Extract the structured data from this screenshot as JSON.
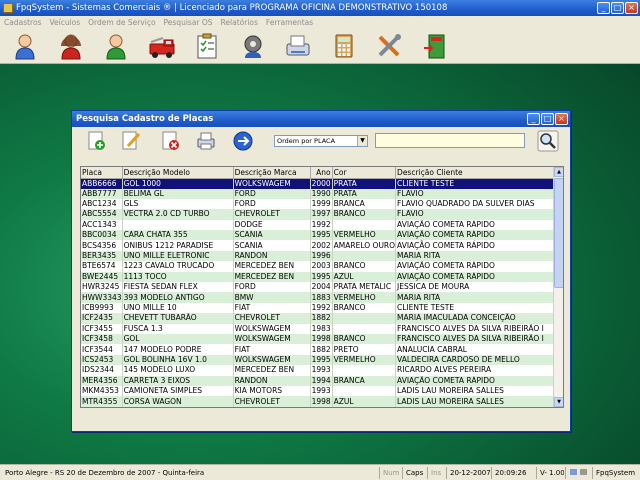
{
  "app": {
    "title": "FpqSystem - Sistemas Comerciais ® | Licenciado para  PROGRAMA OFICINA DEMONSTRATIVO 150108"
  },
  "menu": [
    "Cadastros",
    "Veículos",
    "Ordem de Serviço",
    "Pesquisar OS",
    "Relatórios",
    "Ferramentas"
  ],
  "toolbar_icons": [
    "client-person-icon",
    "user-red-icon",
    "user-green-icon",
    "fire-truck-icon",
    "clipboard-checklist-icon",
    "mechanic-icon",
    "fax-printer-icon",
    "calculator-icon",
    "tools-icon",
    "exit-door-icon"
  ],
  "dialog": {
    "title": "Pesquisa Cadastro de Placas",
    "order_value": "Ordem por PLACA",
    "search_value": "",
    "columns": [
      "Placa",
      "Descrição Modelo",
      "Descrição Marca",
      "Ano",
      "Cor",
      "Descrição Cliente"
    ],
    "rows": [
      [
        "ABB6666",
        "GOL 1000",
        "WOLKSWAGEM",
        "2000",
        "PRATA",
        "CLIENTE TESTE"
      ],
      [
        "ABB7777",
        "BELIMA GL",
        "FORD",
        "1990",
        "PRATA",
        "FLAVIO"
      ],
      [
        "ABC1234",
        "GLS",
        "FORD",
        "1999",
        "BRANCA",
        "FLAVIO QUADRADO DA SULVER DIAS"
      ],
      [
        "ABC5554",
        "VECTRA 2.0 CD TURBO",
        "CHEVROLET",
        "1997",
        "BRANCO",
        "FLAVIO"
      ],
      [
        "ACC1343",
        "",
        "DODGE",
        "1992",
        "",
        "AVIAÇÃO COMETA RÁPIDO"
      ],
      [
        "BBC0034",
        "CARA CHATA 355",
        "SCANIA",
        "1995",
        "VERMELHO",
        "AVIAÇÃO COMETA RÁPIDO"
      ],
      [
        "BCS4356",
        "ONIBUS 1212 PARADISE",
        "SCANIA",
        "2002",
        "AMARELO OURO",
        "AVIAÇÃO COMETA RÁPIDO"
      ],
      [
        "BER3435",
        "UNO MILLE ELETRONIC",
        "RANDON",
        "1996",
        "",
        "MARIA RITA"
      ],
      [
        "BTE6574",
        "1223 CAVALO TRUCADO",
        "MERCEDEZ BEN",
        "2003",
        "BRANCO",
        "AVIAÇÃO COMETA RÁPIDO"
      ],
      [
        "BWE2445",
        "1113 TOCO",
        "MERCEDEZ BEN",
        "1995",
        "AZUL",
        "AVIAÇÃO COMETA RÁPIDO"
      ],
      [
        "HWR3245",
        "FIESTA SEDAN FLEX",
        "FORD",
        "2004",
        "PRATA METALIC",
        "JESSICA DE MOURA"
      ],
      [
        "HWW3343",
        "393 MODELO ANTIGO",
        "BMW",
        "1883",
        "VERMELHO",
        "MARIA RITA"
      ],
      [
        "ICB9993",
        "UNO MILLE 10",
        "FIAT",
        "1992",
        "BRANCO",
        "CLIENTE TESTE"
      ],
      [
        "ICF2435",
        "CHEVETT TUBARÃO",
        "CHEVROLET",
        "1882",
        "",
        "MARIA IMACULADA CONCEIÇÃO"
      ],
      [
        "ICF3455",
        "FUSCA 1.3",
        "WOLKSWAGEM",
        "1983",
        "",
        "FRANCISCO ALVES DA SILVA RIBEIRÃO I"
      ],
      [
        "ICF3458",
        "GOL",
        "WOLKSWAGEM",
        "1998",
        "BRANCO",
        "FRANCISCO ALVES DA SILVA RIBEIRÃO I"
      ],
      [
        "ICF3544",
        "147 MODELO PODRE",
        "FIAT",
        "1882",
        "PRETO",
        "ANALUCIA CABRAL"
      ],
      [
        "ICS2453",
        "GOL BOLINHA 16V 1.0",
        "WOLKSWAGEM",
        "1995",
        "VERMELHO",
        "VALDECIRA CARDOSO DE MELLO"
      ],
      [
        "IDS2344",
        "145 MODELO LUXO",
        "MERCEDEZ BEN",
        "1993",
        "",
        "RICARDO ALVES PEREIRA"
      ],
      [
        "MER4356",
        "CARRETA 3 EIXOS",
        "RANDON",
        "1994",
        "BRANCA",
        "AVIAÇÃO COMETA RÁPIDO"
      ],
      [
        "MKM4353",
        "CAMIONETA SIMPLES",
        "KIA MOTORS",
        "1993",
        "",
        "LADIS LAU MOREIRA SALLES"
      ],
      [
        "MTR4355",
        "CORSA WAGON",
        "CHEVROLET",
        "1998",
        "AZUL",
        "LADIS LAU MOREIRA SALLES"
      ]
    ]
  },
  "status": {
    "location_date": "Porto Alegre - RS 20 de Dezembro de 2007 - Quinta-feira",
    "num": "Num",
    "caps": "Caps",
    "ins": "Ins",
    "date": "20-12-2007",
    "time": "20:09:26",
    "version": "V-  1.00",
    "app": "FpqSystem"
  }
}
